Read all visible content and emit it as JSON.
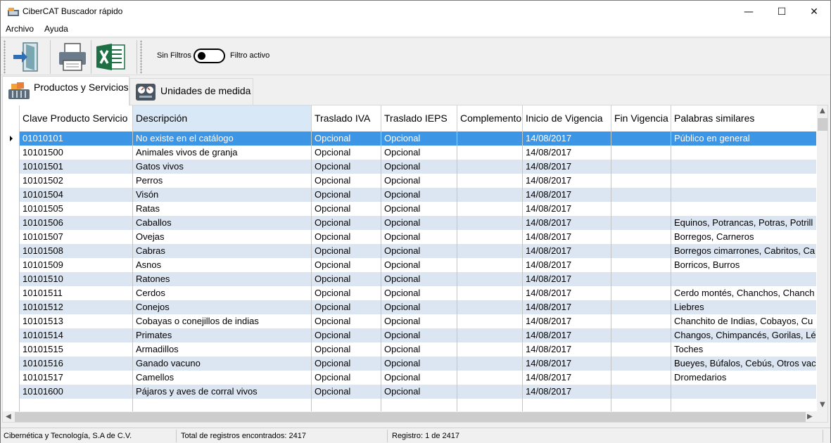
{
  "window": {
    "title": "CiberCAT Buscador rápido",
    "minimize": "—",
    "maximize": "☐",
    "close": "✕"
  },
  "menu": [
    "Archivo",
    "Ayuda"
  ],
  "toolbar": {
    "filter_off_label": "Sin Filtros",
    "filter_on_label": "Filtro activo",
    "filter_active": false
  },
  "tabs": [
    {
      "label": "Productos y Servicios",
      "active": true
    },
    {
      "label": "Unidades de medida",
      "active": false
    }
  ],
  "grid": {
    "columns": [
      "Clave Producto Servicio",
      "Descripción",
      "Traslado IVA",
      "Traslado IEPS",
      "Complemento",
      "Inicio de Vigencia",
      "Fin Vigencia",
      "Palabras similares"
    ],
    "rows": [
      [
        "01010101",
        "No existe en el catálogo",
        "Opcional",
        "Opcional",
        "",
        "14/08/2017",
        "",
        "Público en general"
      ],
      [
        "10101500",
        "Animales vivos de granja",
        "Opcional",
        "Opcional",
        "",
        "14/08/2017",
        "",
        ""
      ],
      [
        "10101501",
        "Gatos vivos",
        "Opcional",
        "Opcional",
        "",
        "14/08/2017",
        "",
        ""
      ],
      [
        "10101502",
        "Perros",
        "Opcional",
        "Opcional",
        "",
        "14/08/2017",
        "",
        ""
      ],
      [
        "10101504",
        "Visón",
        "Opcional",
        "Opcional",
        "",
        "14/08/2017",
        "",
        ""
      ],
      [
        "10101505",
        "Ratas",
        "Opcional",
        "Opcional",
        "",
        "14/08/2017",
        "",
        ""
      ],
      [
        "10101506",
        "Caballos",
        "Opcional",
        "Opcional",
        "",
        "14/08/2017",
        "",
        "Equinos, Potrancas, Potras, Potrill"
      ],
      [
        "10101507",
        "Ovejas",
        "Opcional",
        "Opcional",
        "",
        "14/08/2017",
        "",
        "Borregos, Carneros"
      ],
      [
        "10101508",
        "Cabras",
        "Opcional",
        "Opcional",
        "",
        "14/08/2017",
        "",
        "Borregos cimarrones, Cabritos, Ca"
      ],
      [
        "10101509",
        "Asnos",
        "Opcional",
        "Opcional",
        "",
        "14/08/2017",
        "",
        "Borricos, Burros"
      ],
      [
        "10101510",
        "Ratones",
        "Opcional",
        "Opcional",
        "",
        "14/08/2017",
        "",
        ""
      ],
      [
        "10101511",
        "Cerdos",
        "Opcional",
        "Opcional",
        "",
        "14/08/2017",
        "",
        "Cerdo montés, Chanchos, Chanch"
      ],
      [
        "10101512",
        "Conejos",
        "Opcional",
        "Opcional",
        "",
        "14/08/2017",
        "",
        "Liebres"
      ],
      [
        "10101513",
        "Cobayas o conejillos de indias",
        "Opcional",
        "Opcional",
        "",
        "14/08/2017",
        "",
        "Chanchito de Indias, Cobayos, Cu"
      ],
      [
        "10101514",
        "Primates",
        "Opcional",
        "Opcional",
        "",
        "14/08/2017",
        "",
        "Changos, Chimpancés, Gorilas, Lé"
      ],
      [
        "10101515",
        "Armadillos",
        "Opcional",
        "Opcional",
        "",
        "14/08/2017",
        "",
        "Toches"
      ],
      [
        "10101516",
        "Ganado vacuno",
        "Opcional",
        "Opcional",
        "",
        "14/08/2017",
        "",
        "Bueyes, Búfalos, Cebús, Otros vac"
      ],
      [
        "10101517",
        "Camellos",
        "Opcional",
        "Opcional",
        "",
        "14/08/2017",
        "",
        "Dromedarios"
      ],
      [
        "10101600",
        "Pájaros y aves de corral vivos",
        "Opcional",
        "Opcional",
        "",
        "14/08/2017",
        "",
        ""
      ]
    ],
    "selected_row": 0
  },
  "status": {
    "company": "Cibernética y Tecnología, S.A de C.V.",
    "total": "Total de registros encontrados: 2417",
    "record": "Registro: 1 de 2417"
  },
  "colors": {
    "selection": "#3d95e6",
    "alt_row": "#dce6f2",
    "header_selected": "#d9e8f7"
  }
}
